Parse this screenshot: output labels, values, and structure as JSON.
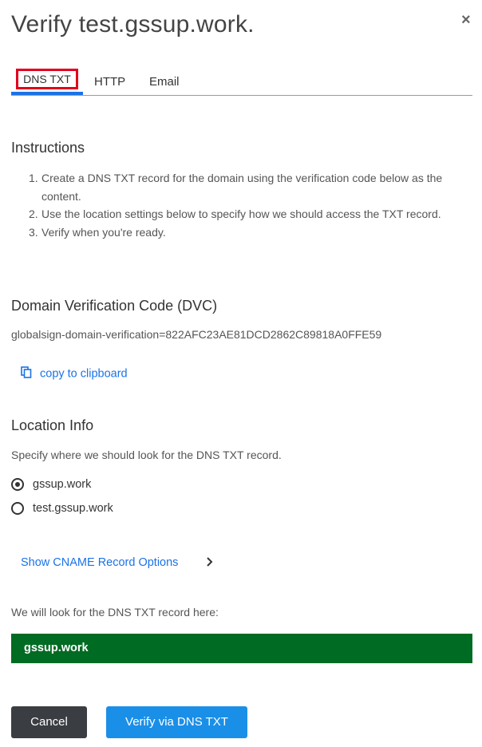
{
  "dialog": {
    "title": "Verify test.gssup.work.",
    "close_label": "×"
  },
  "tabs": [
    {
      "label": "DNS TXT",
      "active": true
    },
    {
      "label": "HTTP",
      "active": false
    },
    {
      "label": "Email",
      "active": false
    }
  ],
  "instructions": {
    "heading": "Instructions",
    "steps": [
      {
        "num": "1.",
        "text": "Create a DNS TXT record for the domain using the verification code below as the content."
      },
      {
        "num": "2.",
        "text": "Use the location settings below to specify how we should access the TXT record."
      },
      {
        "num": "3.",
        "text": "Verify when you're ready."
      }
    ]
  },
  "dvc": {
    "heading": "Domain Verification Code (DVC)",
    "code": "globalsign-domain-verification=822AFC23AE81DCD2862C89818A0FFE59",
    "copy_label": "copy to clipboard"
  },
  "location": {
    "heading": "Location Info",
    "description": "Specify where we should look for the DNS TXT record.",
    "options": [
      {
        "label": "gssup.work",
        "selected": true
      },
      {
        "label": "test.gssup.work",
        "selected": false
      }
    ],
    "cname_label": "Show CNAME Record Options",
    "look_here_label": "We will look for the DNS TXT record here:",
    "target": "gssup.work"
  },
  "buttons": {
    "cancel": "Cancel",
    "verify": "Verify via DNS TXT"
  },
  "colors": {
    "accent": "#1a73e8",
    "target_bar": "#006b22",
    "tab_highlight": "#e3001b"
  }
}
